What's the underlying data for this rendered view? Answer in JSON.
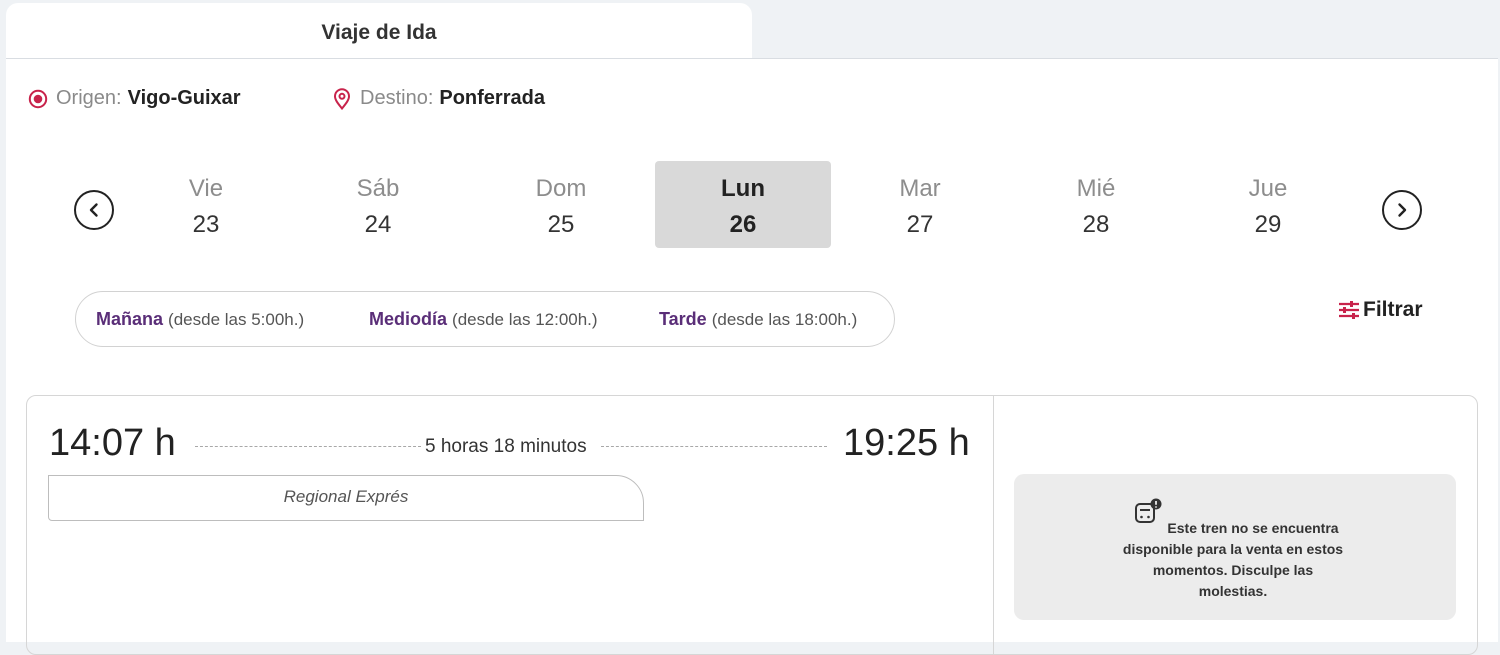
{
  "tab": {
    "label": "Viaje de Ida"
  },
  "route": {
    "origin_label": "Origen:",
    "origin_value": "Vigo-Guixar",
    "destination_label": "Destino:",
    "destination_value": "Ponferrada"
  },
  "dates": [
    {
      "day": "Vie",
      "num": "23",
      "selected": false
    },
    {
      "day": "Sáb",
      "num": "24",
      "selected": false
    },
    {
      "day": "Dom",
      "num": "25",
      "selected": false
    },
    {
      "day": "Lun",
      "num": "26",
      "selected": true
    },
    {
      "day": "Mar",
      "num": "27",
      "selected": false
    },
    {
      "day": "Mié",
      "num": "28",
      "selected": false
    },
    {
      "day": "Jue",
      "num": "29",
      "selected": false
    }
  ],
  "time_filters": [
    {
      "name": "Mañana",
      "range": "(desde las 5:00h.)"
    },
    {
      "name": "Mediodía",
      "range": "(desde las 12:00h.)"
    },
    {
      "name": "Tarde",
      "range": "(desde las 18:00h.)"
    }
  ],
  "filter": {
    "label": "Filtrar"
  },
  "train": {
    "departure": "14:07 h",
    "arrival": "19:25 h",
    "duration": "5 horas 18 minutos",
    "service": "Regional Exprés",
    "unavailable_message": "Este tren no se encuentra disponible para la venta en estos momentos. Disculpe las molestias."
  },
  "colors": {
    "accent_icon": "#c8234b",
    "time_filter_text": "#5a2e78",
    "selected_day_bg": "#d9d9d9",
    "page_bg": "#eff2f5"
  },
  "icons": {
    "origin": "radio-target-icon",
    "destination": "map-pin-icon",
    "prev": "chevron-left-circle-icon",
    "next": "chevron-right-circle-icon",
    "filter": "sliders-icon",
    "unavailable": "train-alert-icon"
  }
}
